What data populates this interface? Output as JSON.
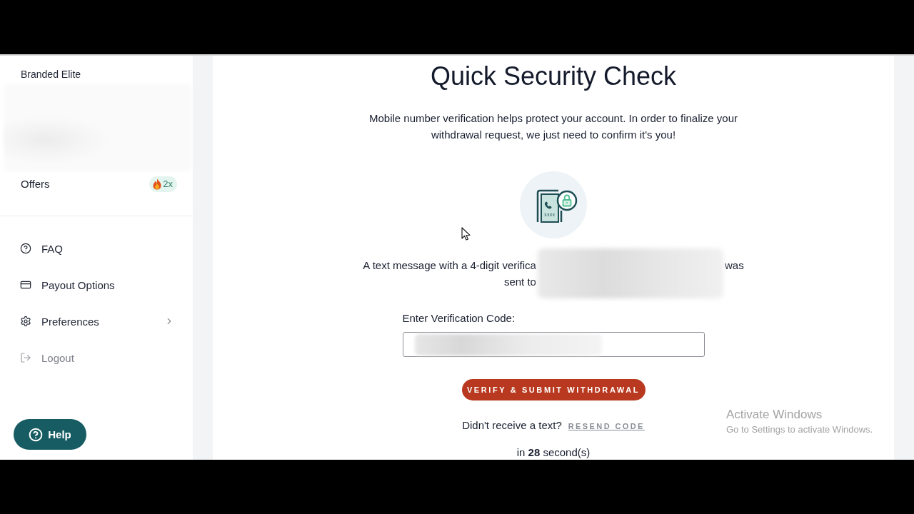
{
  "sidebar": {
    "brand": "Branded Elite",
    "offers": {
      "label": "Offers",
      "badge": "2x"
    },
    "menu": [
      {
        "label": "FAQ",
        "muted": false,
        "expandable": false
      },
      {
        "label": "Payout Options",
        "muted": false,
        "expandable": false
      },
      {
        "label": "Preferences",
        "muted": false,
        "expandable": true
      },
      {
        "label": "Logout",
        "muted": true,
        "expandable": false
      }
    ],
    "help_button": "Help"
  },
  "main": {
    "title": "Quick Security Check",
    "intro": "Mobile number verification helps protect your account. In order to finalize your withdrawal request, we just need to confirm it's you!",
    "illustration_code": "xxxx",
    "message": {
      "line_1_start": "A text message with a 4-digit verifica",
      "line_1_end": "was",
      "line_2_start": "sent to"
    },
    "code_field": {
      "label": "Enter Verification Code:"
    },
    "submit_button": "VERIFY & SUBMIT WITHDRAWAL",
    "resend": {
      "prompt": "Didn't receive a text?",
      "link": "RESEND CODE"
    },
    "timer": "in **28** second(s)"
  },
  "os_notice": {
    "title": "Activate Windows",
    "subtitle": "Go to Settings to activate Windows."
  }
}
